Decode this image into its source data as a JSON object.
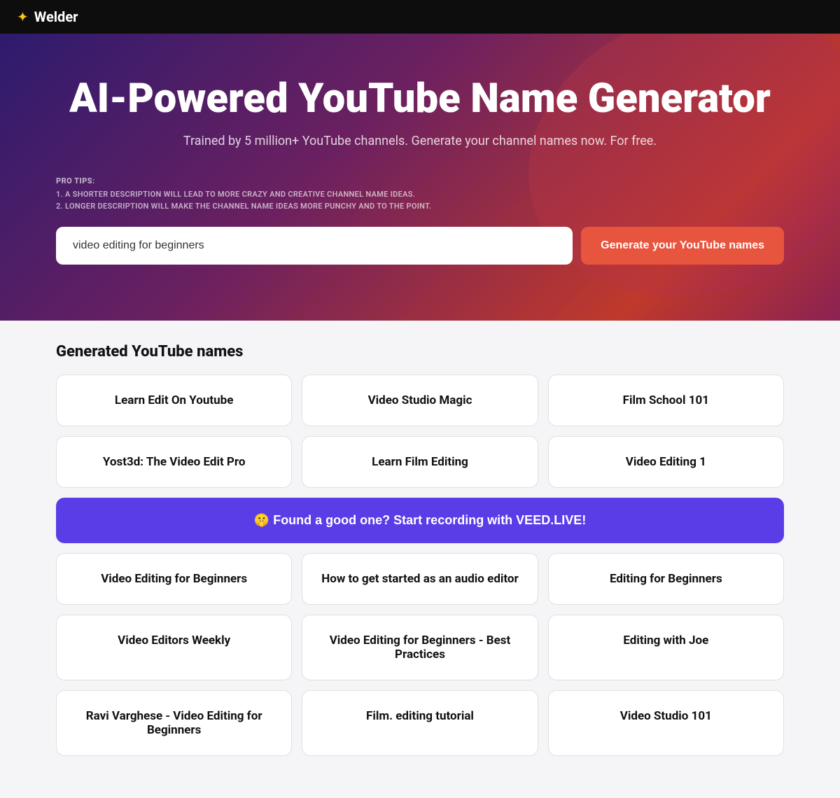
{
  "header": {
    "logo_icon": "✦",
    "logo_text": "Welder"
  },
  "hero": {
    "title": "AI-Powered YouTube Name Generator",
    "subtitle": "Trained by 5 million+ YouTube channels. Generate your channel names now. For free.",
    "pro_tips_label": "PRO TIPS:",
    "pro_tip_1": "1. A SHORTER DESCRIPTION WILL LEAD TO MORE CRAZY AND CREATIVE CHANNEL NAME IDEAS.",
    "pro_tip_2": "2. LONGER DESCRIPTION WILL MAKE THE CHANNEL NAME IDEAS MORE PUNCHY AND TO THE POINT.",
    "input_value": "video editing for beginners",
    "input_placeholder": "video editing for beginners",
    "generate_button_label": "Generate your YouTube names"
  },
  "results": {
    "section_title": "Generated YouTube names",
    "names": [
      {
        "id": 1,
        "label": "Learn Edit On Youtube"
      },
      {
        "id": 2,
        "label": "Video Studio Magic"
      },
      {
        "id": 3,
        "label": "Film School 101"
      },
      {
        "id": 4,
        "label": "Yost3d: The Video Edit Pro"
      },
      {
        "id": 5,
        "label": "Learn Film Editing"
      },
      {
        "id": 6,
        "label": "Video Editing 1"
      },
      {
        "id": 7,
        "label": "promo",
        "is_promo": true,
        "promo_text": "🤫 Found a good one? Start recording with VEED.LIVE!"
      },
      {
        "id": 8,
        "label": "Video Editing for Beginners"
      },
      {
        "id": 9,
        "label": "How to get started as an audio editor"
      },
      {
        "id": 10,
        "label": "Editing for Beginners"
      },
      {
        "id": 11,
        "label": "Video Editors Weekly"
      },
      {
        "id": 12,
        "label": "Video Editing for Beginners - Best Practices"
      },
      {
        "id": 13,
        "label": "Editing with Joe"
      },
      {
        "id": 14,
        "label": "Ravi Varghese - Video Editing for Beginners"
      },
      {
        "id": 15,
        "label": "Film. editing tutorial"
      },
      {
        "id": 16,
        "label": "Video Studio 101"
      }
    ],
    "promo_text": "🤫 Found a good one? Start recording with VEED.LIVE!"
  }
}
